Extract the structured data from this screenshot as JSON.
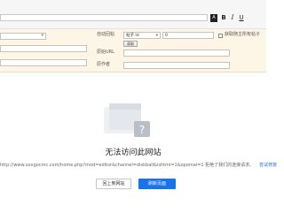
{
  "toolbar": {
    "color_label": "A",
    "bold_label": "B",
    "italic_label": "I",
    "underline_label": "U"
  },
  "form": {
    "auto_reply_label": "自动回帖",
    "reply_select_value": "帖子 Id",
    "reply_number_value": "0",
    "get_button_label": "获取",
    "get_all_label": "获取随主所有帖子",
    "source_url_label": "原始URL",
    "author_label": "原作者"
  },
  "error": {
    "title": "无法访问此网站",
    "detail": "http://www.xxxgocmc.com/home.php?mod=editor&channel=diskball&ishtml=1&opomal=1 拒绝了我们的连接请求。",
    "help_link": "尝试修复",
    "back_button": "回上到网站",
    "refresh_button": "刷新页面"
  },
  "colors": {
    "form_background": "#fdf5e6",
    "primary_button": "#1a73e8",
    "link": "#2d6cdf"
  },
  "icons": {
    "broken_page": "broken-page-icon",
    "dropdown": "chevron-down-icon"
  }
}
